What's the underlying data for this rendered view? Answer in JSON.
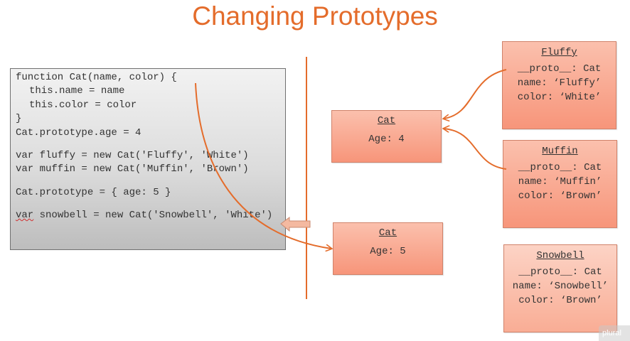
{
  "slide": {
    "title": "Changing Prototypes",
    "colors": {
      "accent": "#e46c2b",
      "box_fill": "#f7957a",
      "code_bg": "#d9d9d9"
    }
  },
  "code": {
    "lines": [
      "function Cat(name, color) {",
      "this.name = name",
      "this.color = color",
      "}",
      "Cat.prototype.age = 4",
      "var fluffy = new Cat('Fluffy', 'White')",
      "var muffin = new Cat('Muffin', 'Brown')",
      "Cat.prototype = { age: 5 }",
      "var",
      " snowbell = new Cat('Snowbell', 'White')"
    ]
  },
  "objects": {
    "cat_old": {
      "title": "Cat",
      "age": "Age: 4"
    },
    "cat_new": {
      "title": "Cat",
      "age": "Age: 5"
    },
    "fluffy": {
      "title": "Fluffy",
      "proto": "__proto__: Cat",
      "name": "name: ‘Fluffy’",
      "color": "color: ‘White’"
    },
    "muffin": {
      "title": "Muffin",
      "proto": "__proto__: Cat",
      "name": "name: ‘Muffin’",
      "color": "color: ‘Brown’"
    },
    "snowbell": {
      "title": "Snowbell",
      "proto": "__proto__: Cat",
      "name": "name: ‘Snowbell’",
      "color": "color: ‘Brown’"
    }
  },
  "watermark": {
    "text": "plural"
  }
}
